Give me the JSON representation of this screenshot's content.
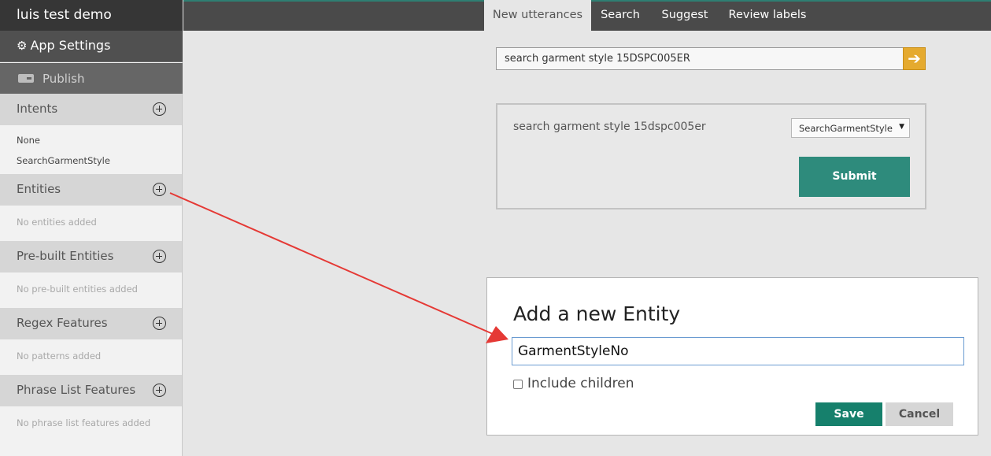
{
  "app": {
    "title": "luis test demo"
  },
  "sidebar": {
    "settings_label": "App Settings",
    "settings_icon": "gear-icon",
    "publish_label": "Publish",
    "sections": [
      {
        "label": "Intents",
        "items": [
          "None",
          "SearchGarmentStyle"
        ],
        "empty": ""
      },
      {
        "label": "Entities",
        "items": [],
        "empty": "No entities added"
      },
      {
        "label": "Pre-built Entities",
        "items": [],
        "empty": "No pre-built entities added"
      },
      {
        "label": "Regex Features",
        "items": [],
        "empty": "No patterns added"
      },
      {
        "label": "Phrase List Features",
        "items": [],
        "empty": "No phrase list features added"
      }
    ]
  },
  "tabs": [
    {
      "label": "New utterances",
      "active": true
    },
    {
      "label": "Search",
      "active": false
    },
    {
      "label": "Suggest",
      "active": false
    },
    {
      "label": "Review labels",
      "active": false
    }
  ],
  "search": {
    "value": "search garment style 15DSPC005ER",
    "go_icon": "arrow-right-icon"
  },
  "utterance": {
    "text": "search garment style 15dspc005er",
    "intent_selected": "SearchGarmentStyle",
    "submit_label": "Submit"
  },
  "dialog": {
    "title": "Add a new Entity",
    "entity_value": "GarmentStyleNo",
    "include_children_label": "Include children",
    "include_children_checked": false,
    "save_label": "Save",
    "cancel_label": "Cancel"
  },
  "colors": {
    "accent": "#2e8b7c",
    "save": "#16806c",
    "search_go": "#e5aa2f",
    "annotation": "#e53935"
  }
}
